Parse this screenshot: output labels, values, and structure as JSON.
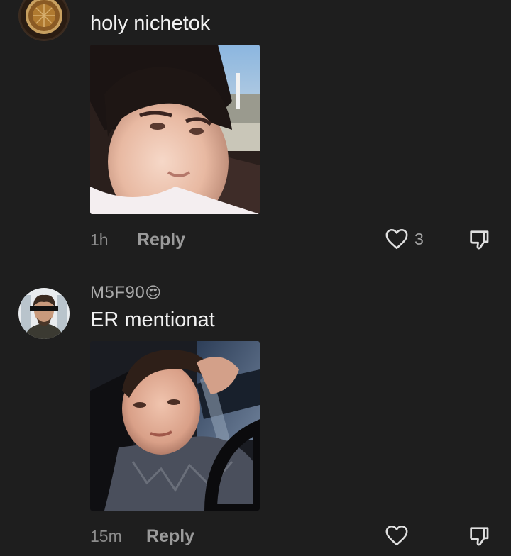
{
  "comments": [
    {
      "username": "",
      "text": "holy nichetok",
      "time": "1h",
      "reply_label": "Reply",
      "like_count": "3",
      "avatar_icon": "tea-cup-avatar",
      "image_subject": "selfie-in-car"
    },
    {
      "username": "M5F90",
      "username_emoji": "😍",
      "text": "ER mentionat",
      "time": "15m",
      "reply_label": "Reply",
      "like_count": "",
      "avatar_icon": "person-censored-eyes-avatar",
      "image_subject": "selfie-driving"
    }
  ],
  "colors": {
    "background": "#1e1e1e",
    "text": "#f2f2f2",
    "muted": "#8d8d8d",
    "action": "#9a9a9a",
    "emoji": "#f5a623"
  }
}
